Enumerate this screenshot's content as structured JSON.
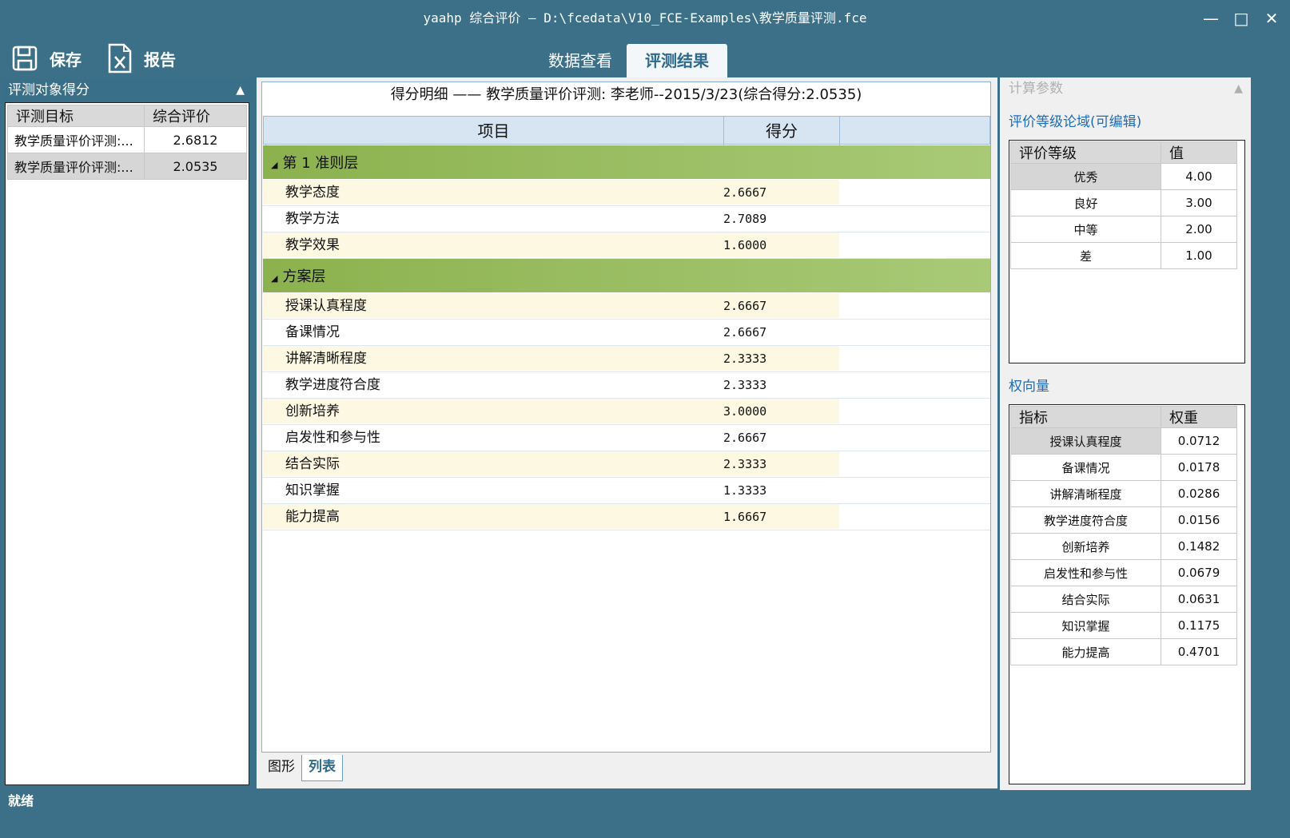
{
  "window": {
    "title": "yaahp 综合评价 — D:\\fcedata\\V10_FCE-Examples\\教学质量评测.fce"
  },
  "toolbar": {
    "save_label": "保存",
    "report_label": "报告"
  },
  "tabs": [
    {
      "label": "数据查看"
    },
    {
      "label": "评测结果"
    }
  ],
  "left_panel": {
    "title": "评测对象得分",
    "headers": [
      "评测目标",
      "综合评价"
    ],
    "rows": [
      {
        "name": "教学质量评价评测:...",
        "value": "2.6812"
      },
      {
        "name": "教学质量评价评测:...",
        "value": "2.0535"
      }
    ]
  },
  "center": {
    "title": "得分明细 —— 教学质量评价评测: 李老师--2015/3/23(综合得分:2.0535)",
    "headers": [
      "项目",
      "得分"
    ],
    "groups": [
      {
        "label": "第 1 准则层",
        "items": [
          {
            "name": "教学态度",
            "score": "2.6667"
          },
          {
            "name": "教学方法",
            "score": "2.7089"
          },
          {
            "name": "教学效果",
            "score": "1.6000"
          }
        ]
      },
      {
        "label": "方案层",
        "items": [
          {
            "name": "授课认真程度",
            "score": "2.6667"
          },
          {
            "name": "备课情况",
            "score": "2.6667"
          },
          {
            "name": "讲解清晰程度",
            "score": "2.3333"
          },
          {
            "name": "教学进度符合度",
            "score": "2.3333"
          },
          {
            "name": "创新培养",
            "score": "3.0000"
          },
          {
            "name": "启发性和参与性",
            "score": "2.6667"
          },
          {
            "name": "结合实际",
            "score": "2.3333"
          },
          {
            "name": "知识掌握",
            "score": "1.3333"
          },
          {
            "name": "能力提高",
            "score": "1.6667"
          }
        ]
      }
    ],
    "bottom_tabs": [
      {
        "label": "图形"
      },
      {
        "label": "列表"
      }
    ]
  },
  "right_panel": {
    "title": "计算参数",
    "grade_label": "评价等级论域(可编辑)",
    "grade_headers": [
      "评价等级",
      "值"
    ],
    "grades": [
      {
        "k": "优秀",
        "v": "4.00"
      },
      {
        "k": "良好",
        "v": "3.00"
      },
      {
        "k": "中等",
        "v": "2.00"
      },
      {
        "k": "差",
        "v": "1.00"
      }
    ],
    "weight_label": "权向量",
    "weight_headers": [
      "指标",
      "权重"
    ],
    "weights": [
      {
        "k": "授课认真程度",
        "v": "0.0712"
      },
      {
        "k": "备课情况",
        "v": "0.0178"
      },
      {
        "k": "讲解清晰程度",
        "v": "0.0286"
      },
      {
        "k": "教学进度符合度",
        "v": "0.0156"
      },
      {
        "k": "创新培养",
        "v": "0.1482"
      },
      {
        "k": "启发性和参与性",
        "v": "0.0679"
      },
      {
        "k": "结合实际",
        "v": "0.0631"
      },
      {
        "k": "知识掌握",
        "v": "0.1175"
      },
      {
        "k": "能力提高",
        "v": "0.4701"
      }
    ]
  },
  "status": {
    "text": "就绪"
  }
}
